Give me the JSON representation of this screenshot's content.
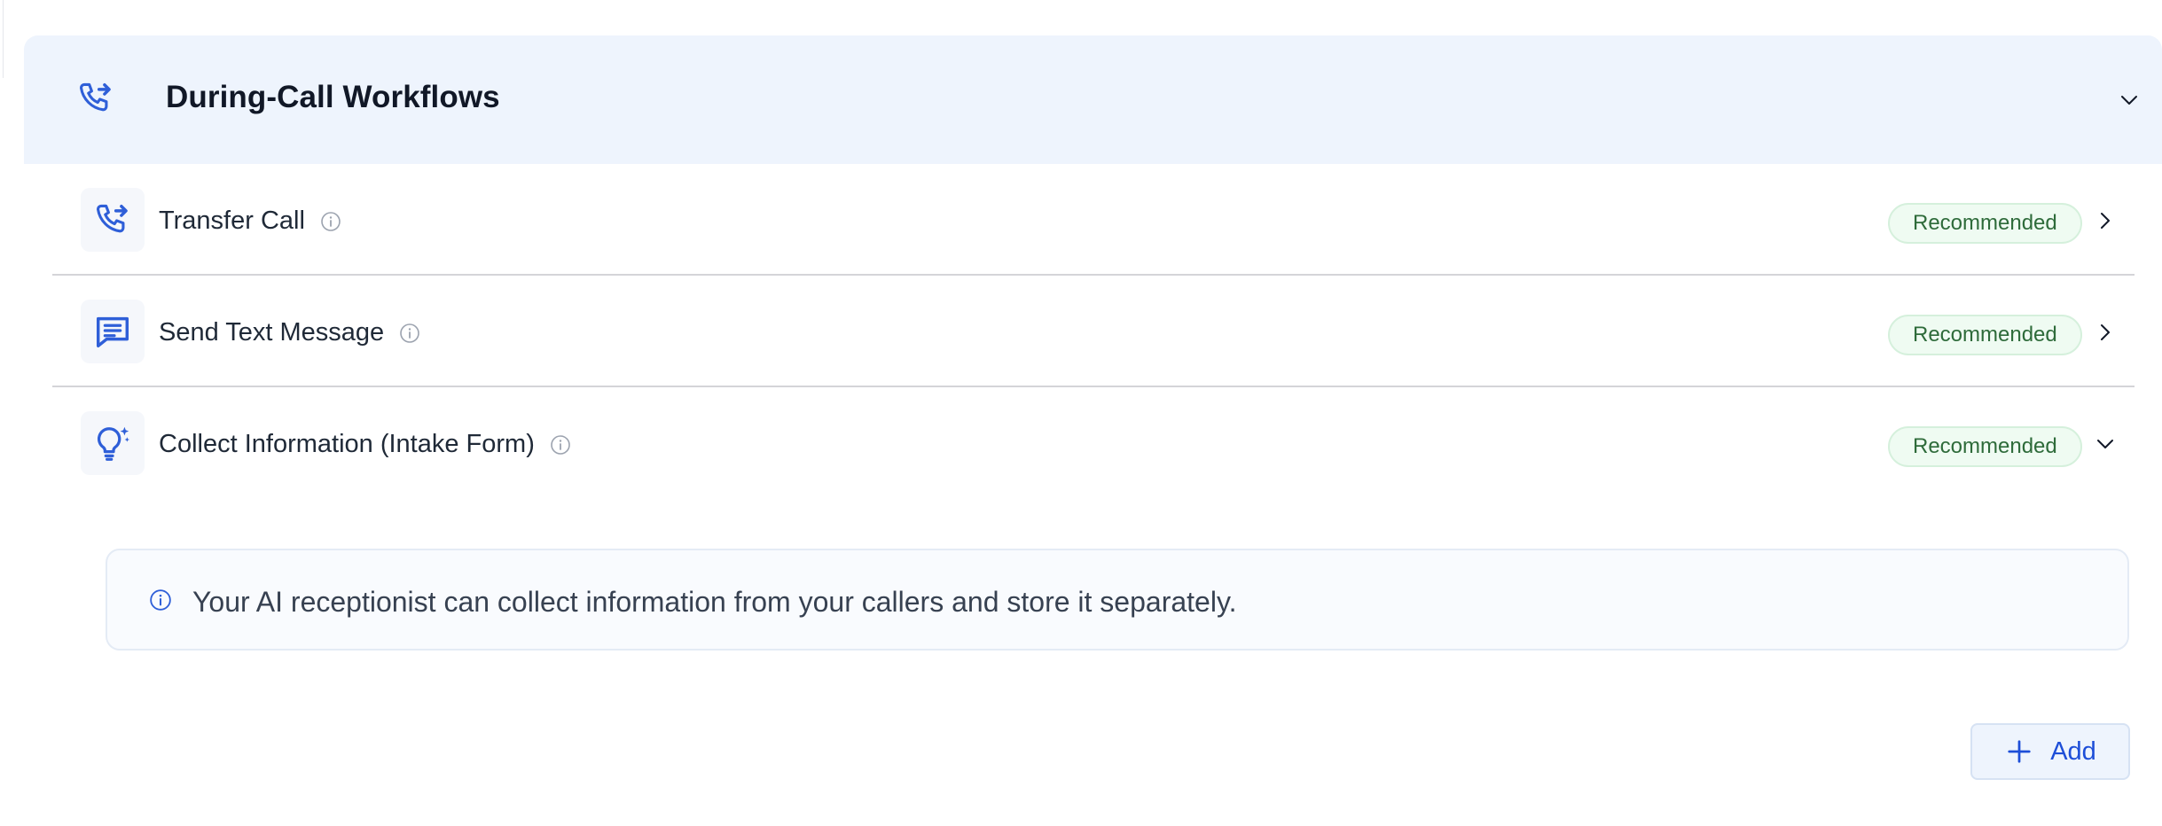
{
  "section": {
    "title": "During-Call Workflows",
    "icon": "phone-forward-icon",
    "toggle_icon": "chevron-down-icon"
  },
  "workflows": [
    {
      "label": "Transfer Call",
      "icon": "phone-forward-icon",
      "info_icon": "info-icon",
      "badge": "Recommended",
      "toggle_icon": "chevron-right-icon"
    },
    {
      "label": "Send Text Message",
      "icon": "message-icon",
      "info_icon": "info-icon",
      "badge": "Recommended",
      "toggle_icon": "chevron-right-icon"
    },
    {
      "label": "Collect Information (Intake Form)",
      "icon": "lightbulb-sparkle-icon",
      "info_icon": "info-icon",
      "badge": "Recommended",
      "toggle_icon": "chevron-down-icon"
    }
  ],
  "intake_note": {
    "icon": "info-icon",
    "text": "Your AI receptionist can collect information from your callers and store it separately."
  },
  "add_button": {
    "label": "Add",
    "icon": "plus-icon"
  },
  "colors": {
    "accent": "#2f5fd8",
    "header_bg": "#eef4fd",
    "badge_bg": "#effbf2",
    "badge_text": "#2e6b3a"
  }
}
